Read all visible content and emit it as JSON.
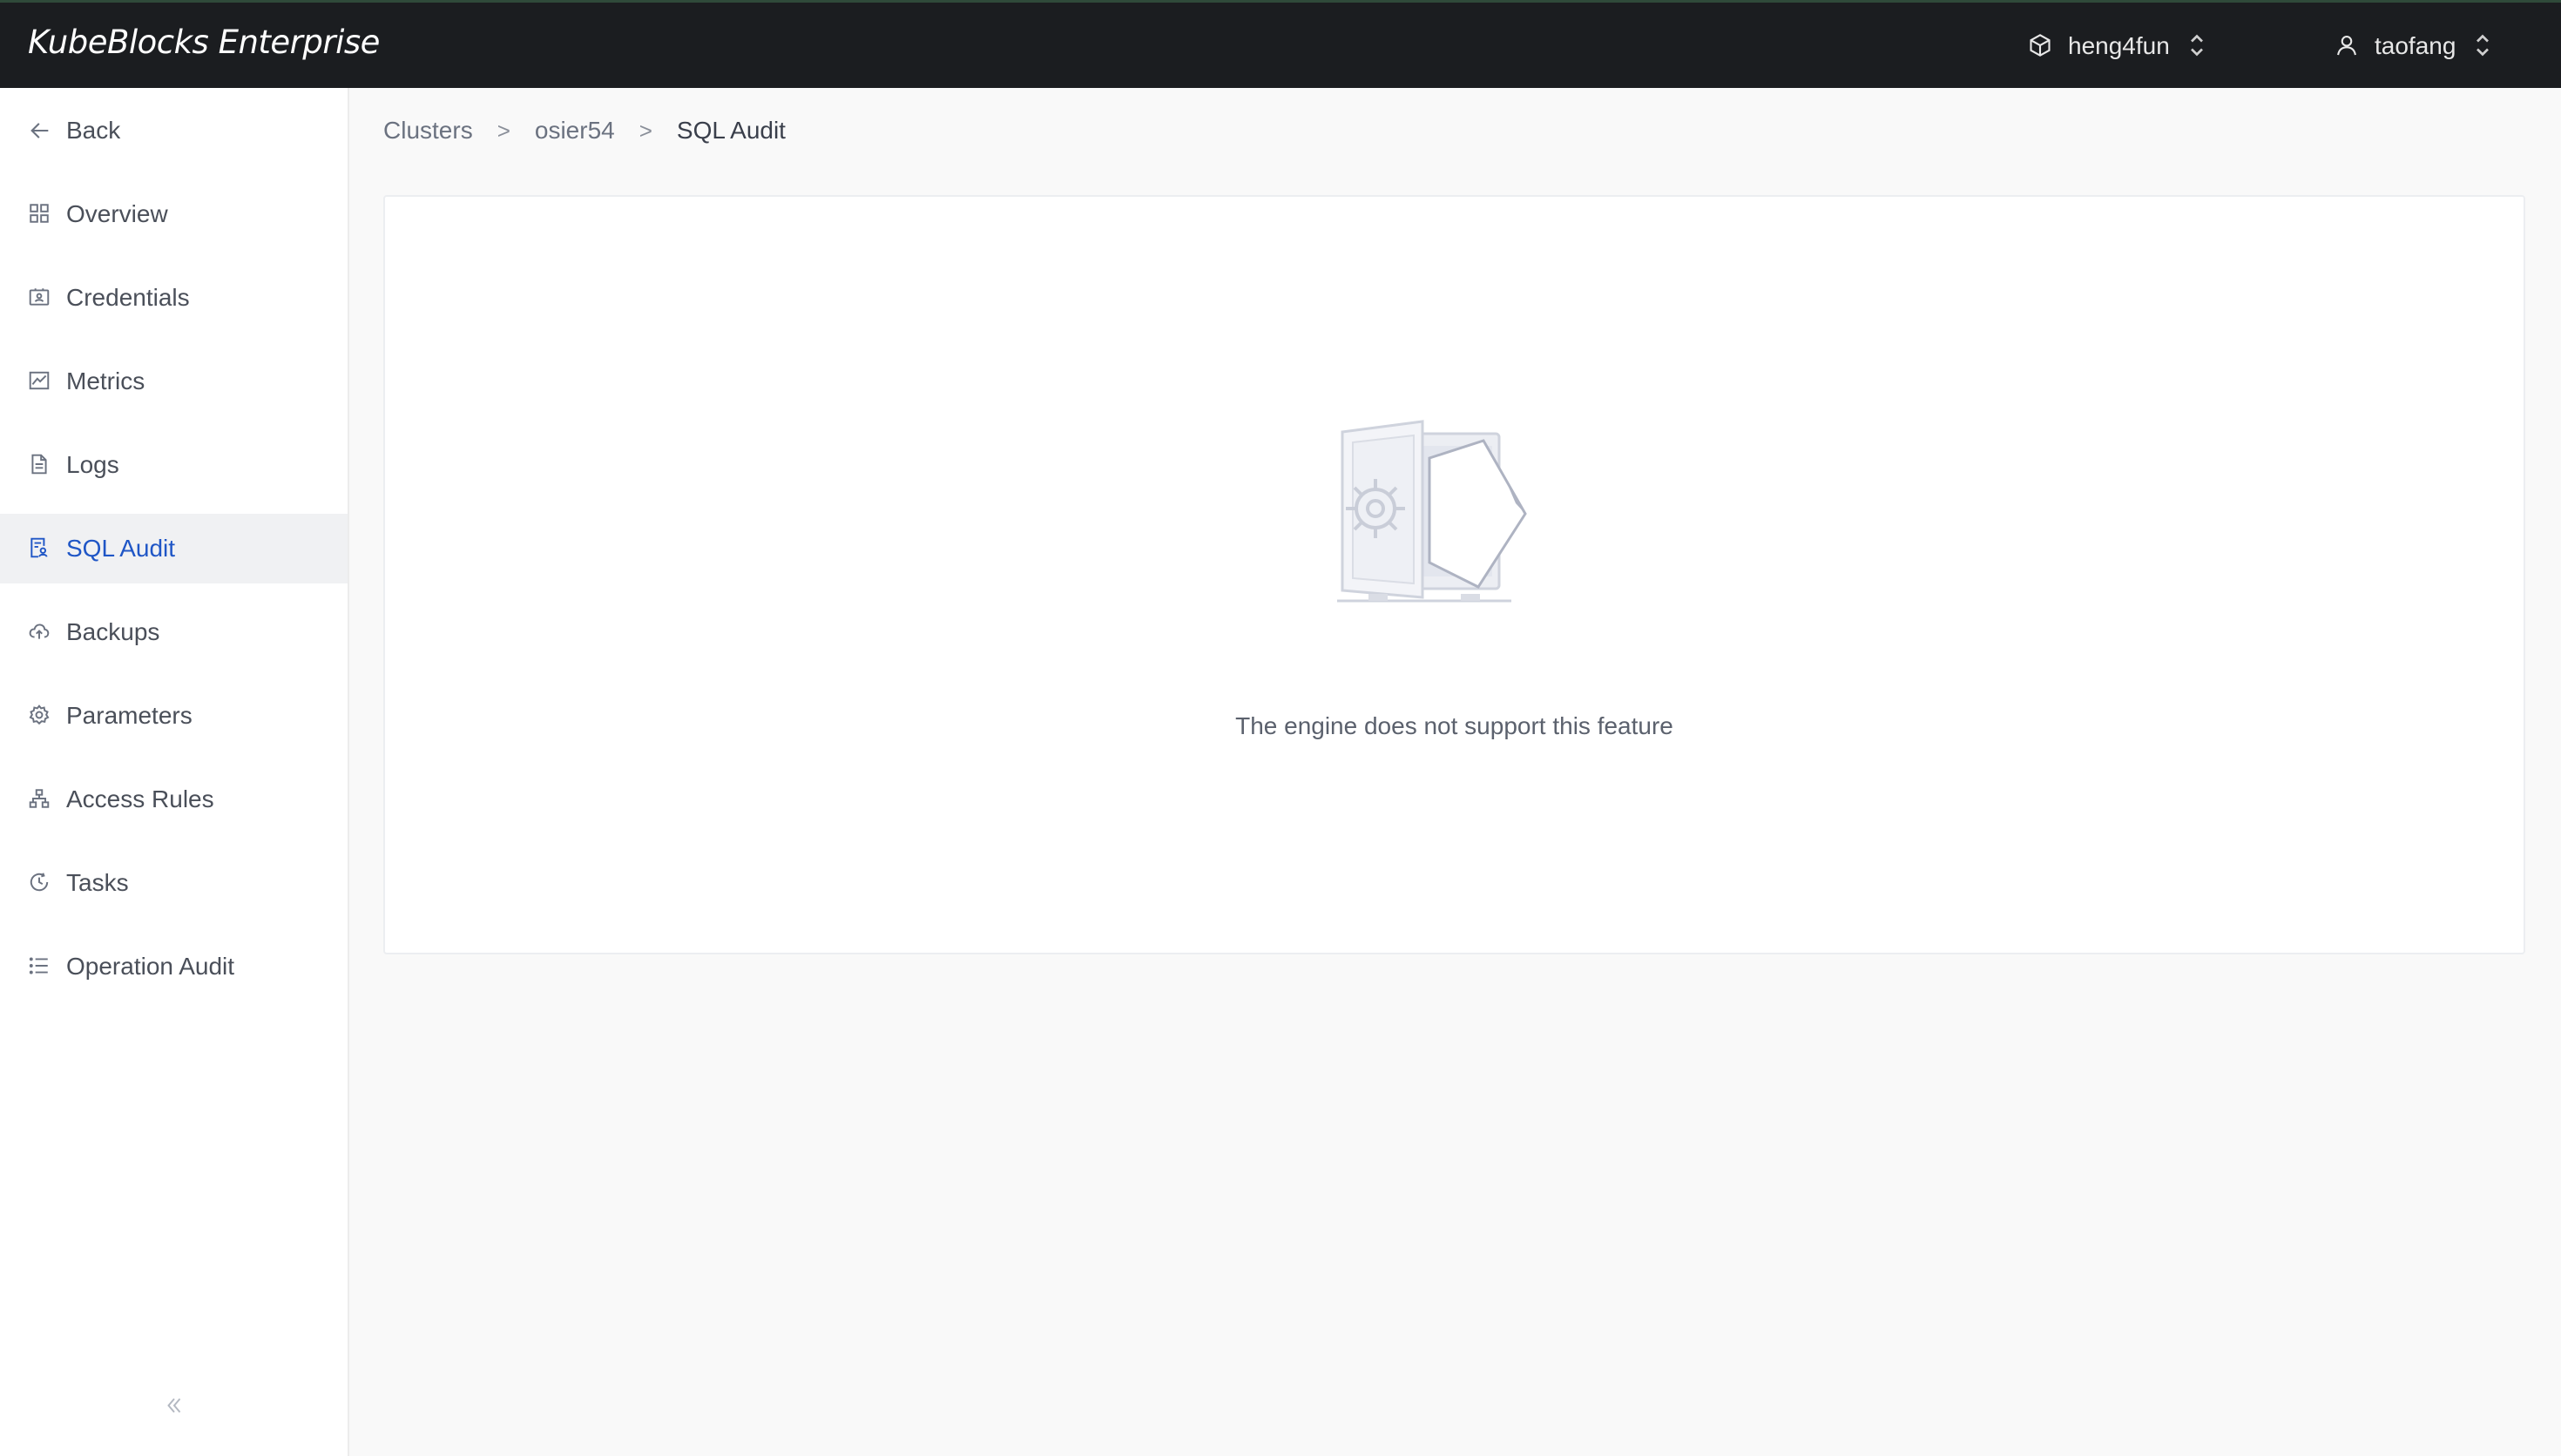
{
  "app": {
    "brand": "KubeBlocks Enterprise",
    "workspace": "heng4fun",
    "user": "taofang"
  },
  "sidebar": {
    "items": [
      {
        "label": "Back",
        "icon": "arrow-left-icon"
      },
      {
        "label": "Overview",
        "icon": "grid-icon"
      },
      {
        "label": "Credentials",
        "icon": "credentials-icon"
      },
      {
        "label": "Metrics",
        "icon": "chart-icon"
      },
      {
        "label": "Logs",
        "icon": "file-icon"
      },
      {
        "label": "SQL Audit",
        "icon": "sql-audit-icon",
        "active": true
      },
      {
        "label": "Backups",
        "icon": "cloud-upload-icon"
      },
      {
        "label": "Parameters",
        "icon": "gear-icon"
      },
      {
        "label": "Access Rules",
        "icon": "network-icon"
      },
      {
        "label": "Tasks",
        "icon": "clock-icon"
      },
      {
        "label": "Operation Audit",
        "icon": "list-icon"
      }
    ],
    "collapse_icon": "double-chevron-left-icon"
  },
  "breadcrumb": {
    "items": [
      "Clusters",
      "osier54",
      "SQL Audit"
    ],
    "separator": ">"
  },
  "main": {
    "empty_message": "The engine does not support this feature",
    "empty_icon": "vault-empty-illustration"
  },
  "colors": {
    "topbar_bg": "#1b1d20",
    "accent": "#1f56c6",
    "active_bg": "#f0f1f3",
    "page_bg": "#f9f9f9"
  }
}
